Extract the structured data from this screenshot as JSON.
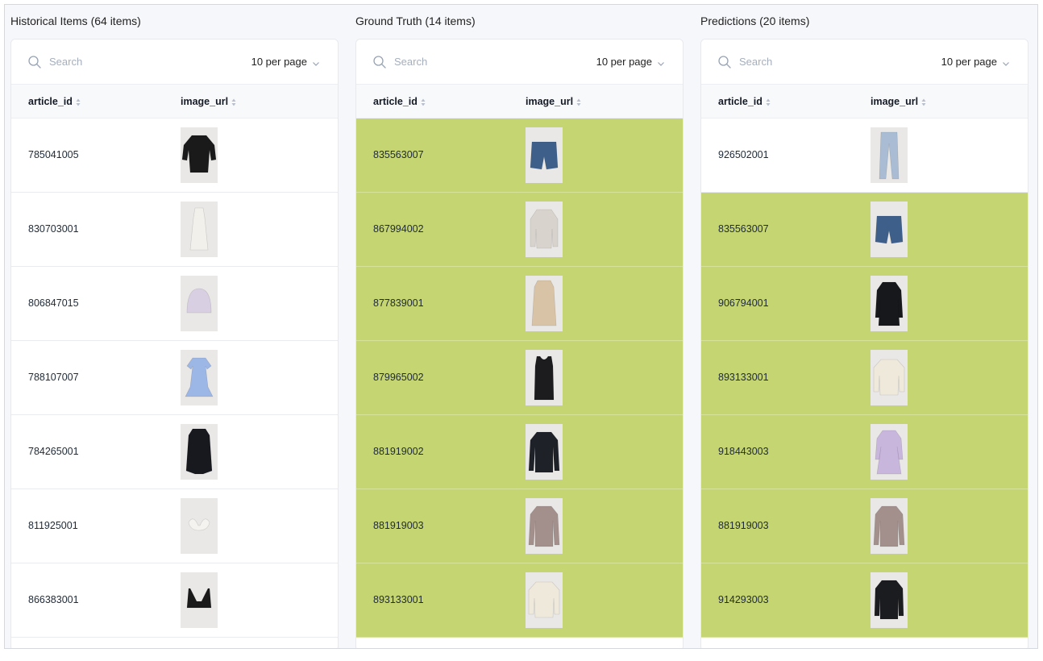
{
  "colors": {
    "match_highlight": "#c5d572",
    "header_bg": "#f8f9fb",
    "thumb_bg": "#e9e8e6"
  },
  "panels": [
    {
      "title": "Historical Items (64 items)",
      "search_placeholder": "Search",
      "per_page": "10 per page",
      "columns": [
        "article_id",
        "image_url"
      ],
      "rows": [
        {
          "article_id": "785041005",
          "highlighted": false,
          "image": "black-long-sleeve-bodysuit",
          "color": "#1a1a1a"
        },
        {
          "article_id": "830703001",
          "highlighted": false,
          "image": "white-slip-dress",
          "color": "#f2f0ea"
        },
        {
          "article_id": "806847015",
          "highlighted": false,
          "image": "lilac-beanie",
          "color": "#d9cfe3"
        },
        {
          "article_id": "788107007",
          "highlighted": false,
          "image": "blue-ruffle-dress",
          "color": "#9cb6e6"
        },
        {
          "article_id": "784265001",
          "highlighted": false,
          "image": "black-coat",
          "color": "#17191f"
        },
        {
          "article_id": "811925001",
          "highlighted": false,
          "image": "white-bikini-top",
          "color": "#f4f3ef"
        },
        {
          "article_id": "866383001",
          "highlighted": false,
          "image": "black-bikini-top",
          "color": "#1a1a1a"
        }
      ]
    },
    {
      "title": "Ground Truth (14 items)",
      "search_placeholder": "Search",
      "per_page": "10 per page",
      "columns": [
        "article_id",
        "image_url"
      ],
      "rows": [
        {
          "article_id": "835563007",
          "highlighted": true,
          "image": "denim-shorts",
          "color": "#3e5f8a"
        },
        {
          "article_id": "867994002",
          "highlighted": true,
          "image": "beige-quilted-jacket",
          "color": "#d8d4cd"
        },
        {
          "article_id": "877839001",
          "highlighted": true,
          "image": "beige-trench-coat",
          "color": "#d9c3a6"
        },
        {
          "article_id": "879965002",
          "highlighted": true,
          "image": "black-tank-top",
          "color": "#1c1c1e"
        },
        {
          "article_id": "881919002",
          "highlighted": true,
          "image": "black-long-sleeve-top",
          "color": "#1e2128"
        },
        {
          "article_id": "881919003",
          "highlighted": true,
          "image": "mauve-long-sleeve-top",
          "color": "#a3908d"
        },
        {
          "article_id": "893133001",
          "highlighted": true,
          "image": "cream-sweater",
          "color": "#efe9dc"
        }
      ]
    },
    {
      "title": "Predictions (20 items)",
      "search_placeholder": "Search",
      "per_page": "10 per page",
      "columns": [
        "article_id",
        "image_url"
      ],
      "rows": [
        {
          "article_id": "926502001",
          "highlighted": false,
          "image": "light-blue-jeans",
          "color": "#a9bcd3"
        },
        {
          "article_id": "835563007",
          "highlighted": true,
          "image": "denim-shorts",
          "color": "#3e5f8a"
        },
        {
          "article_id": "906794001",
          "highlighted": true,
          "image": "black-shirt-dress",
          "color": "#16181c"
        },
        {
          "article_id": "893133001",
          "highlighted": true,
          "image": "cream-sweater",
          "color": "#efe9dc"
        },
        {
          "article_id": "918443003",
          "highlighted": true,
          "image": "lilac-smock-dress",
          "color": "#c8b6dc"
        },
        {
          "article_id": "881919003",
          "highlighted": true,
          "image": "mauve-long-sleeve-top",
          "color": "#a3908d"
        },
        {
          "article_id": "914293003",
          "highlighted": true,
          "image": "black-jacket",
          "color": "#1b1c20"
        }
      ]
    }
  ]
}
